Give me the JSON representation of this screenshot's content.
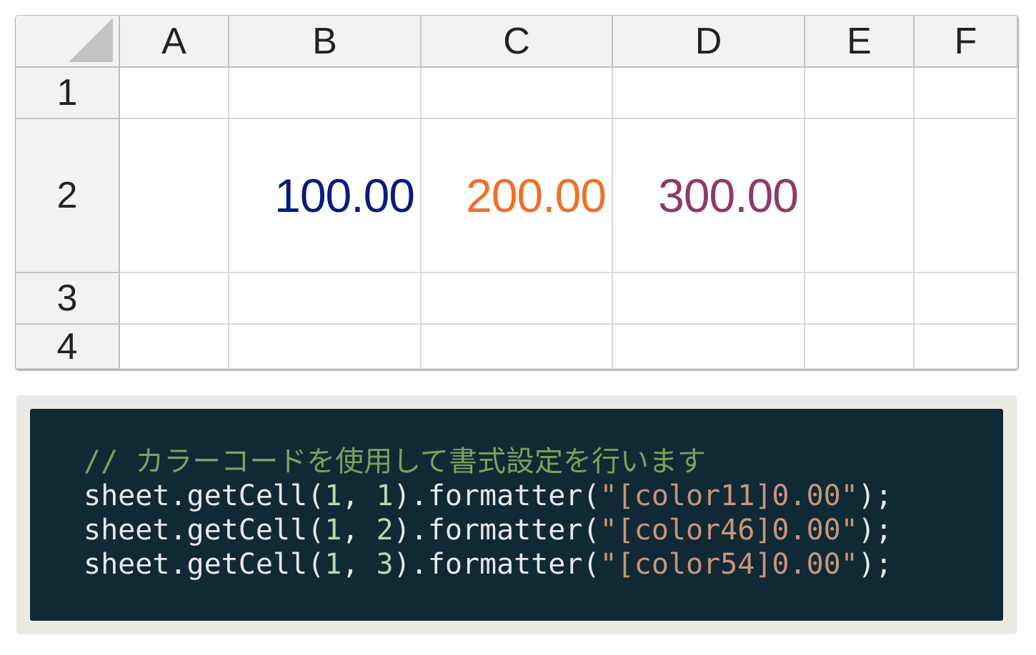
{
  "sheet": {
    "columns": [
      "A",
      "B",
      "C",
      "D",
      "E",
      "F"
    ],
    "rows": [
      "1",
      "2",
      "3",
      "4"
    ],
    "cells": {
      "B2": {
        "text": "100.00",
        "color": "#0a1a7d"
      },
      "C2": {
        "text": "200.00",
        "color": "#f07025"
      },
      "D2": {
        "text": "300.00",
        "color": "#8e3a6a"
      }
    }
  },
  "code": {
    "comment": "// カラーコードを使用して書式設定を行います",
    "lines": [
      {
        "obj": "sheet",
        "dot1": ".",
        "method": "getCell",
        "open": "(",
        "row": "1",
        "sep": ", ",
        "col": "1",
        "close": ")",
        "dot2": ".",
        "method2": "formatter",
        "open2": "(",
        "arg": "\"[color11]0.00\"",
        "end": ");"
      },
      {
        "obj": "sheet",
        "dot1": ".",
        "method": "getCell",
        "open": "(",
        "row": "1",
        "sep": ", ",
        "col": "2",
        "close": ")",
        "dot2": ".",
        "method2": "formatter",
        "open2": "(",
        "arg": "\"[color46]0.00\"",
        "end": ");"
      },
      {
        "obj": "sheet",
        "dot1": ".",
        "method": "getCell",
        "open": "(",
        "row": "1",
        "sep": ", ",
        "col": "3",
        "close": ")",
        "dot2": ".",
        "method2": "formatter",
        "open2": "(",
        "arg": "\"[color54]0.00\"",
        "end": ");"
      }
    ]
  },
  "colors": {
    "code_bg": "#0f2935",
    "frame_bg": "#ecebe3",
    "header_bg": "#f2f2f2"
  }
}
